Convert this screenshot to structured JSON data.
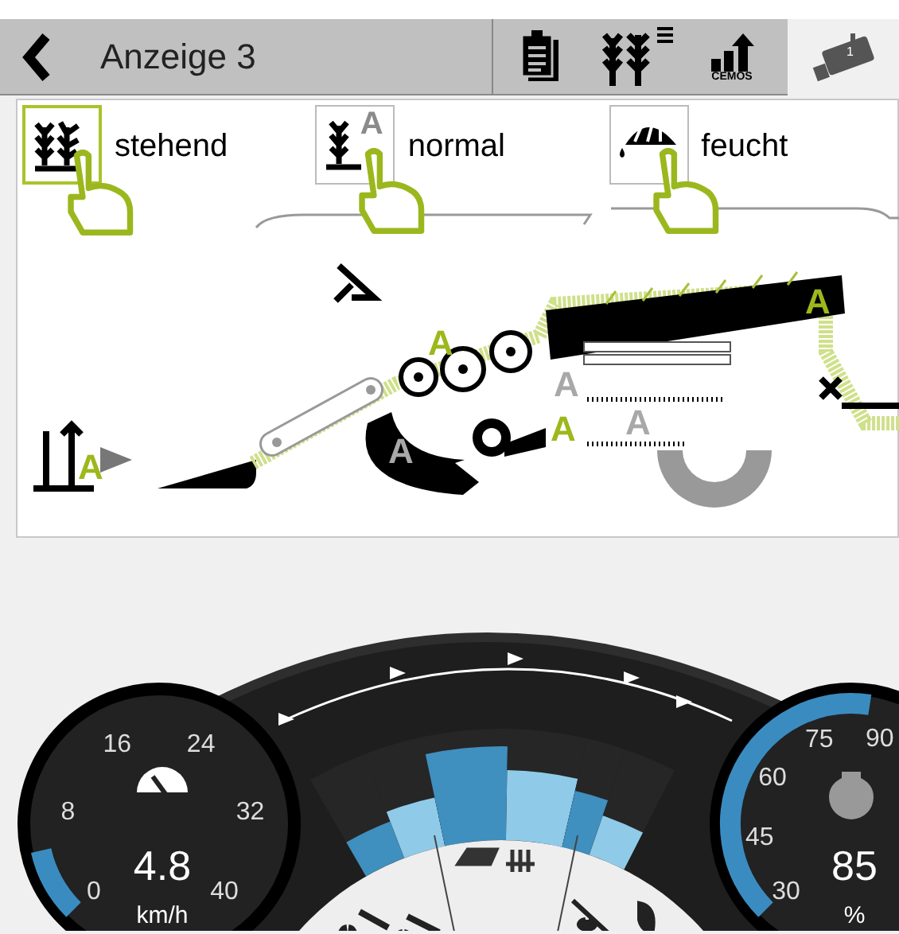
{
  "header": {
    "title": "Anzeige 3"
  },
  "toolbar": [
    {
      "kind": "clipboard",
      "selected": false
    },
    {
      "kind": "crops",
      "selected": false
    },
    {
      "kind": "cemos",
      "label": "CEMOS",
      "selected": false
    },
    {
      "kind": "camera",
      "badge": "1",
      "selected": true
    }
  ],
  "crop_options": [
    {
      "kind": "standing",
      "label": "stehend",
      "selected": true
    },
    {
      "kind": "normal",
      "mark": "A",
      "label": "normal",
      "selected": false
    },
    {
      "kind": "moist",
      "label": "feucht",
      "selected": false
    }
  ],
  "diagram": {
    "markers": [
      {
        "text": "A",
        "active": true
      },
      {
        "text": "A",
        "active": true
      },
      {
        "text": "A",
        "active": false
      },
      {
        "text": "A",
        "active": true
      },
      {
        "text": "A",
        "active": true
      },
      {
        "text": "A",
        "active": false
      },
      {
        "text": "A",
        "active": false
      }
    ]
  },
  "speed_gauge": {
    "ticks": [
      "0",
      "8",
      "16",
      "24",
      "32",
      "40"
    ],
    "value": "4.8",
    "unit": "km/h",
    "level": 0.12
  },
  "load_bars": [
    {
      "level": 0.45,
      "color": "#3f8fbf"
    },
    {
      "level": 0.5,
      "color": "#8fcbe8"
    },
    {
      "level": 0.85,
      "color": "#3f8fbf"
    },
    {
      "level": 0.65,
      "color": "#8fcbe8"
    },
    {
      "level": 0.55,
      "color": "#3f8fbf"
    },
    {
      "level": 0.45,
      "color": "#8fcbe8"
    }
  ],
  "percent_gauge": {
    "ticks": [
      "30",
      "45",
      "60",
      "75",
      "90"
    ],
    "value": "85",
    "unit": "%",
    "level": 0.94
  }
}
